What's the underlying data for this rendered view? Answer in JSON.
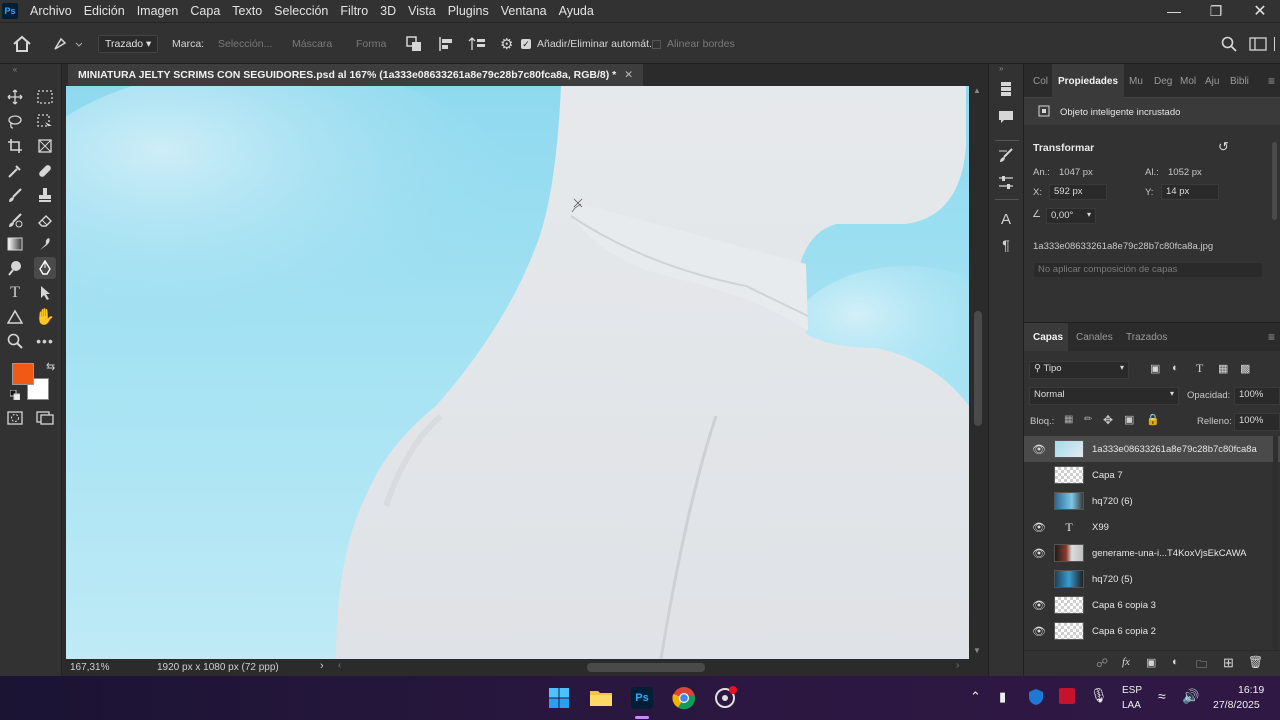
{
  "menubar": {
    "app_logo": "Ps",
    "items": [
      "Archivo",
      "Edición",
      "Imagen",
      "Capa",
      "Texto",
      "Selección",
      "Filtro",
      "3D",
      "Vista",
      "Plugins",
      "Ventana",
      "Ayuda"
    ]
  },
  "options": {
    "mode": "Trazado",
    "marca_label": "Marca:",
    "seleccion": "Selección...",
    "mascara": "Máscara",
    "forma": "Forma",
    "auto_add": "Añadir/Eliminar automát.",
    "align_edges": "Alinear bordes"
  },
  "document": {
    "tab_title": "MINIATURA JELTY SCRIMS CON SEGUIDORES.psd al 167% (1a333e08633261a8e79c28b7c80fca8a, RGB/8) *",
    "zoom": "167,31%",
    "size": "1920 px x 1080 px (72 ppp)"
  },
  "properties": {
    "tabs": [
      "Col",
      "Propiedades",
      "Mu",
      "Deg",
      "Mol",
      "Aju",
      "Bibli"
    ],
    "object_type": "Objeto inteligente incrustado",
    "transform_title": "Transformar",
    "w_label": "An.:",
    "w_value": "1047 px",
    "h_label": "Al.:",
    "h_value": "1052 px",
    "x_label": "X:",
    "x_value": "592 px",
    "y_label": "Y:",
    "y_value": "14 px",
    "angle": "0,00°",
    "source_file": "1a333e08633261a8e79c28b7c80fca8a.jpg",
    "comp_placeholder": "No aplicar composición de capas"
  },
  "layers_panel": {
    "tabs": [
      "Capas",
      "Canales",
      "Trazados"
    ],
    "filter": "Tipo",
    "blend_mode": "Normal",
    "opacity_label": "Opacidad:",
    "opacity": "100%",
    "lock_label": "Bloq.:",
    "fill_label": "Relleno:",
    "fill": "100%",
    "layers": [
      {
        "name": "1a333e08633261a8e79c28b7c80fca8a",
        "visible": true,
        "selected": true,
        "thumb": "photo-smart"
      },
      {
        "name": "Capa 7",
        "visible": false,
        "thumb": "transparent"
      },
      {
        "name": "hq720 (6)",
        "visible": false,
        "thumb": "photo-smart"
      },
      {
        "name": "X99",
        "visible": true,
        "thumb": "text"
      },
      {
        "name": "generame-una-i...T4KoxVjsEkCAWA",
        "visible": true,
        "thumb": "photo-smart"
      },
      {
        "name": "hq720 (5)",
        "visible": false,
        "thumb": "photo-smart"
      },
      {
        "name": "Capa 6 copia 3",
        "visible": true,
        "thumb": "transparent"
      },
      {
        "name": "Capa 6 copia 2",
        "visible": true,
        "thumb": "transparent"
      }
    ]
  },
  "colors": {
    "foreground": "#f05a14",
    "background": "#ffffff",
    "accent": "#31a8ff"
  },
  "taskbar": {
    "lang_top": "ESP",
    "lang_bottom": "LAA",
    "time": "16:19",
    "date": "27/8/2025"
  }
}
